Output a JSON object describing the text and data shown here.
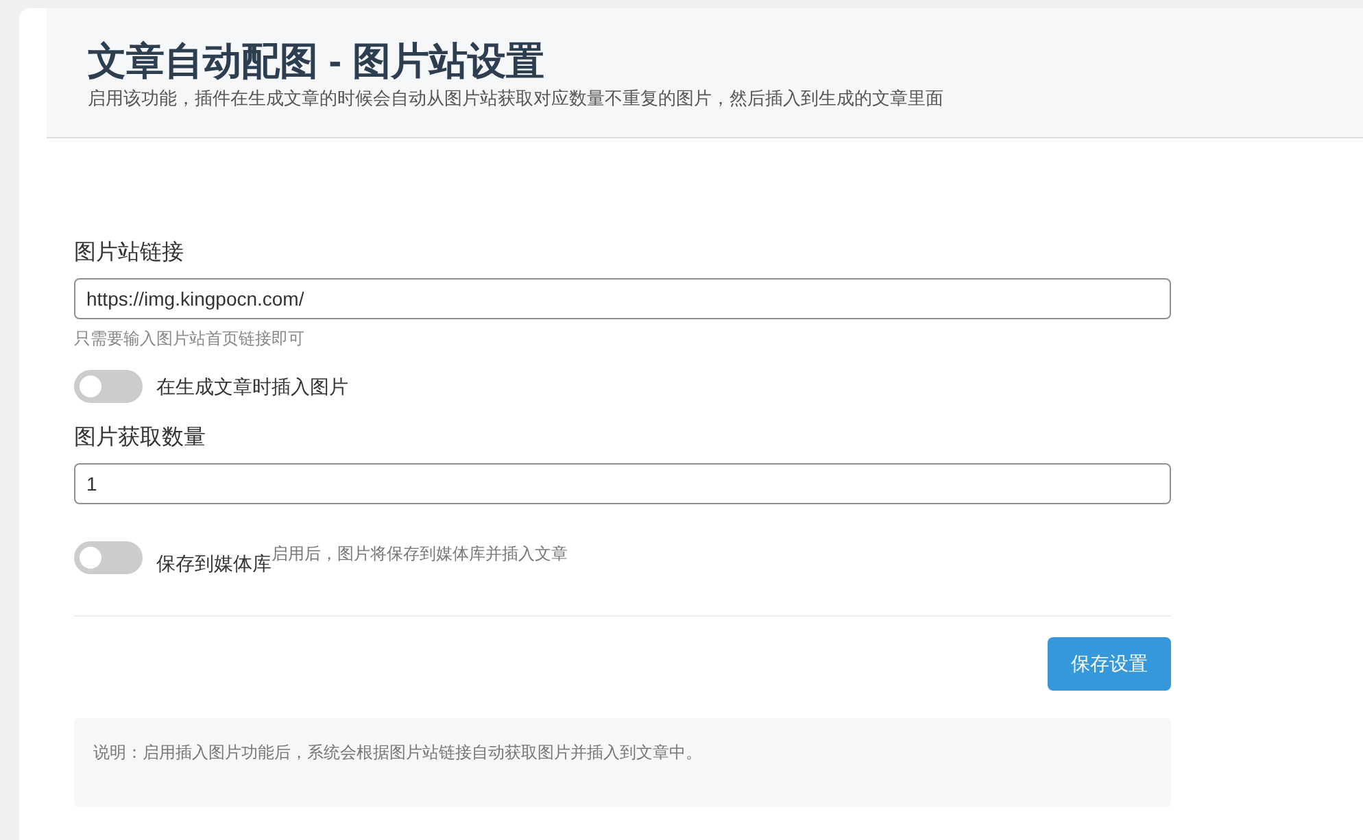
{
  "header": {
    "title": "文章自动配图 - 图片站设置",
    "subtitle": "启用该功能，插件在生成文章的时候会自动从图片站获取对应数量不重复的图片，然后插入到生成的文章里面"
  },
  "fields": [
    {
      "kind": "input",
      "label": "图片站链接",
      "value": "https://img.kingpocn.com/",
      "hint": "只需要输入图片站首页链接即可"
    },
    {
      "kind": "toggle",
      "label": "在生成文章时插入图片",
      "on": false
    },
    {
      "kind": "input",
      "label": "图片获取数量",
      "value": "1"
    },
    {
      "kind": "toggle",
      "label": "保存到媒体库",
      "note": "启用后，图片将保存到媒体库并插入文章",
      "on": false
    }
  ],
  "save_button": "保存设置",
  "info_note": "说明：启用插入图片功能后，系统会根据图片站链接自动获取图片并插入到文章中。"
}
